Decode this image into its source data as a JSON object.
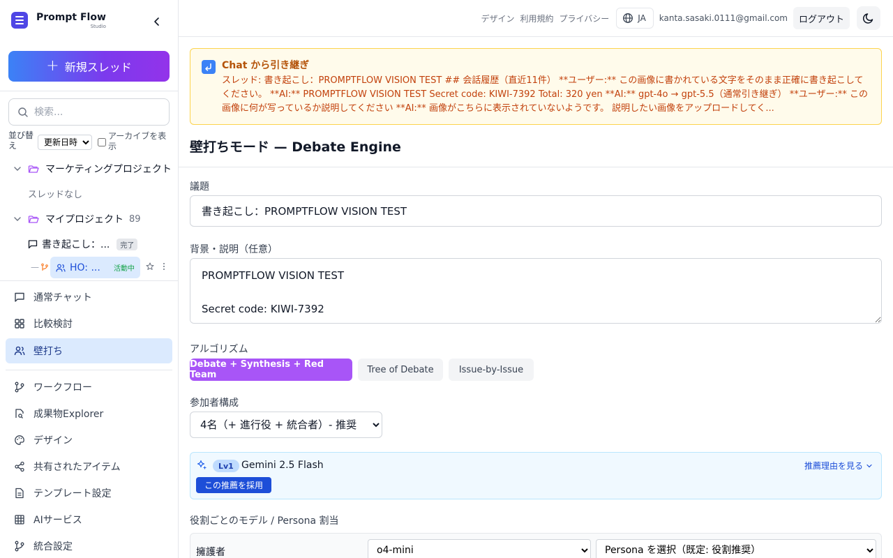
{
  "brand": {
    "title": "Prompt Flow",
    "subtitle": "Studio"
  },
  "sidebar": {
    "new_thread_label": "新規スレッド",
    "search_placeholder": "検索...",
    "sort_label": "並び替え",
    "sort_value": "更新日時",
    "archive_label": "アーカイブを表示",
    "projects": [
      {
        "name": "マーケティングプロジェクト",
        "empty_text": "スレッドなし"
      },
      {
        "name": "マイプロジェクト",
        "count": "89"
      }
    ],
    "threads": [
      {
        "title": "書き起こし：...",
        "badge": "完了"
      },
      {
        "title": "HO: ...",
        "badge": "活動中"
      }
    ],
    "nav": [
      {
        "label": "通常チャット",
        "icon": "chat-bubble-icon"
      },
      {
        "label": "比較検討",
        "icon": "grid-icon"
      },
      {
        "label": "壁打ち",
        "icon": "users-icon"
      },
      {
        "label": "ワークフロー",
        "icon": "git-branch-icon"
      },
      {
        "label": "成果物Explorer",
        "icon": "file-search-icon"
      },
      {
        "label": "デザイン",
        "icon": "palette-icon"
      },
      {
        "label": "共有されたアイテム",
        "icon": "share-icon"
      },
      {
        "label": "テンプレート設定",
        "icon": "document-icon"
      },
      {
        "label": "AIサービス",
        "icon": "table-grid-icon"
      },
      {
        "label": "統合設定",
        "icon": "merge-icon"
      }
    ]
  },
  "topbar": {
    "links": [
      "デザイン",
      "利用規約",
      "プライバシー"
    ],
    "language": "JA",
    "email": "kanta.sasaki.0111@gmail.com",
    "logout_label": "ログアウト"
  },
  "handoff": {
    "title": "Chat から引き継ぎ",
    "body": "スレッド: 書き起こし：PROMPTFLOW VISION TEST ## 会話履歴（直近11件） **ユーザー:** この画像に書かれている文字をそのまま正確に書き起こしてください。 **AI:** PROMPTFLOW VISION TEST Secret code: KIWI-7392 Total: 320 yen **AI:** gpt-4o → gpt-5.5（通常引き継ぎ） **ユーザー:** この画像に何が写っているか説明してください **AI:** 画像がこちらに表示されていないようです。 説明したい画像をアップロードしてく..."
  },
  "page": {
    "title": "壁打ちモード — Debate Engine",
    "topic_label": "議題",
    "topic_value": "書き起こし：PROMPTFLOW VISION TEST",
    "context_label": "背景・説明（任意）",
    "context_value": "PROMPTFLOW VISION TEST\n\nSecret code: KIWI-7392",
    "algorithm_label": "アルゴリズム",
    "algorithms": [
      "Debate + Synthesis + Red Team",
      "Tree of Debate",
      "Issue-by-Issue"
    ],
    "participants_label": "参加者構成",
    "participants_value": "4名（+ 進行役 + 統合者）- 推奨",
    "recommendation": {
      "level": "Lv1",
      "model": "Gemini 2.5 Flash",
      "why_label": "推薦理由を見る",
      "adopt_label": "この推薦を採用"
    },
    "roles_label": "役割ごとのモデル / Persona 割当",
    "roles": [
      {
        "name": "擁護者",
        "model": "o4-mini",
        "persona": "Persona を選択（既定: 役割推奨）"
      }
    ]
  },
  "colors": {
    "accent_gradient_start": "#3b82f6",
    "accent_gradient_end": "#9333ea",
    "algorithm_active": "#a855f7",
    "active_nav_bg": "#dbeafe",
    "handoff_bg": "#fffbeb",
    "handoff_text": "#c2410c"
  }
}
